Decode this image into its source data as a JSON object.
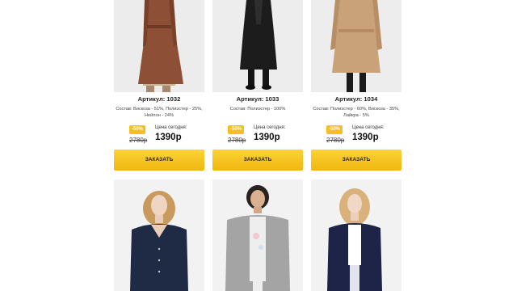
{
  "products": [
    {
      "article": "Артикул: 1032",
      "composition": "Состав: Вискоза - 51%, Полиэстер - 25%, Нейлон - 24%",
      "discount": "-50%",
      "price_label": "Цена сегодня:",
      "old_price": "2780р",
      "new_price": "1390р",
      "button": "ЗАКАЗАТЬ"
    },
    {
      "article": "Артикул: 1033",
      "composition": "Состав: Полиэстер - 100%",
      "discount": "-50%",
      "price_label": "Цена сегодня:",
      "old_price": "2780р",
      "new_price": "1390р",
      "button": "ЗАКАЗАТЬ"
    },
    {
      "article": "Артикул: 1034",
      "composition": "Состав: Полиэстер - 60%, Вискоза - 35%, Лайкра - 5%",
      "discount": "-50%",
      "price_label": "Цена сегодня:",
      "old_price": "2780р",
      "new_price": "1390р",
      "button": "ЗАКАЗАТЬ"
    },
    {
      "article": "",
      "composition": "",
      "discount": "",
      "price_label": "",
      "old_price": "",
      "new_price": "",
      "button": ""
    },
    {
      "article": "",
      "composition": "",
      "discount": "",
      "price_label": "",
      "old_price": "",
      "new_price": "",
      "button": ""
    },
    {
      "article": "",
      "composition": "",
      "discount": "",
      "price_label": "",
      "old_price": "",
      "new_price": "",
      "button": ""
    }
  ],
  "colors": {
    "accent": "#f6bd24",
    "button": "#f4c21b"
  }
}
